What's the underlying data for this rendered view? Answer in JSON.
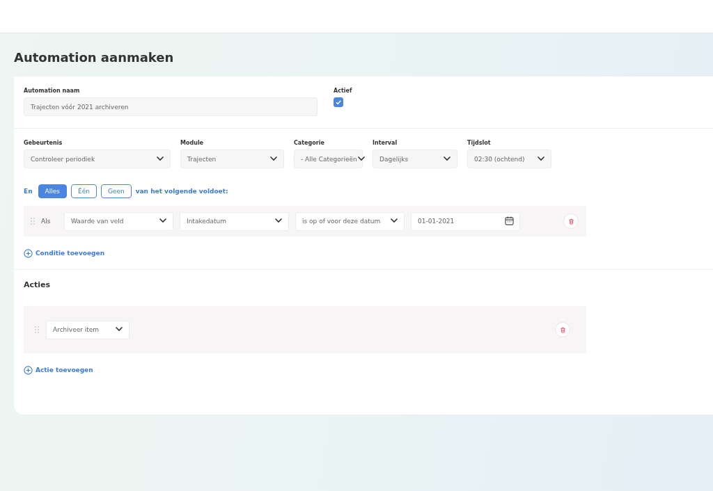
{
  "page": {
    "title": "Automation aanmaken"
  },
  "name_field": {
    "label": "Automation naam",
    "value": "Trajecten vóór 2021 archiveren"
  },
  "active": {
    "label": "Actief",
    "checked": true
  },
  "settings": [
    {
      "label": "Gebeurtenis",
      "value": "Controleer periodiek"
    },
    {
      "label": "Module",
      "value": "Trajecten"
    },
    {
      "label": "Categorie",
      "value": "- Alle Categorieën"
    },
    {
      "label": "Interval",
      "value": "Dagelijks"
    },
    {
      "label": "Tijdslot",
      "value": "02:30 (ochtend)"
    }
  ],
  "match": {
    "prefix": "En",
    "suffix": "van het volgende voldoet:",
    "options": [
      {
        "label": "Alles",
        "selected": true
      },
      {
        "label": "Één",
        "selected": false
      },
      {
        "label": "Geen",
        "selected": false
      }
    ]
  },
  "conditions": [
    {
      "prefix": "Als",
      "fields": [
        {
          "kind": "select",
          "value": "Waarde van veld"
        },
        {
          "kind": "select",
          "value": "Intakedatum"
        },
        {
          "kind": "select",
          "value": "is op of voor deze datum"
        },
        {
          "kind": "date",
          "value": "01-01-2021"
        }
      ]
    }
  ],
  "add_condition": "Conditie toevoegen",
  "actions_title": "Acties",
  "actions": [
    {
      "value": "Archiveer item"
    }
  ],
  "add_action": "Actie toevoegen"
}
